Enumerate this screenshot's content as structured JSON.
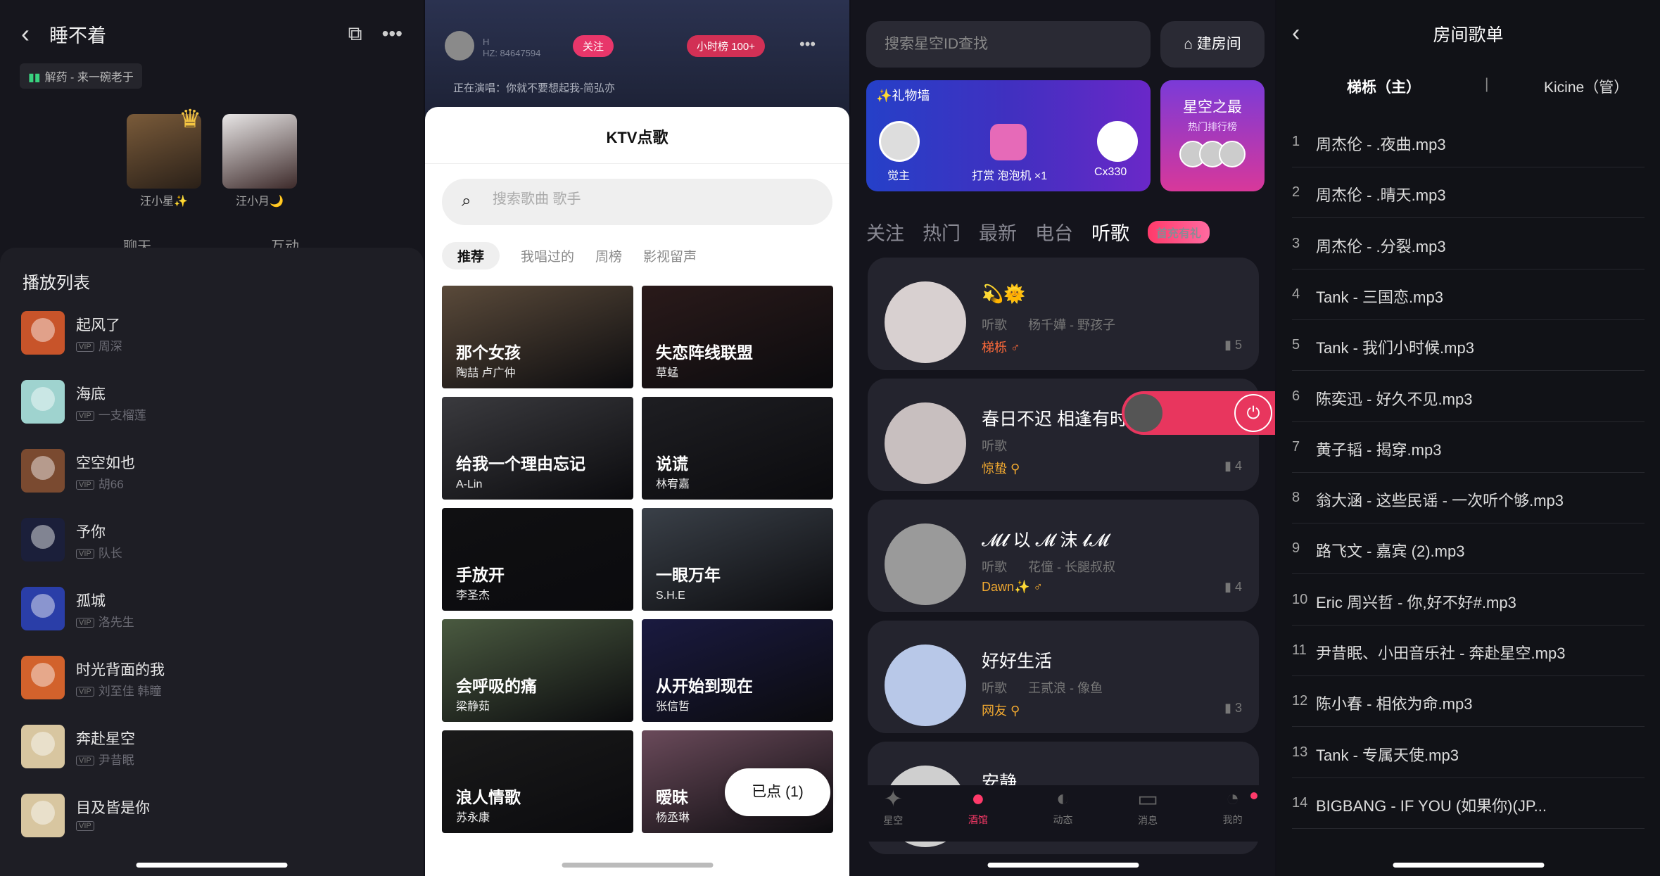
{
  "p1": {
    "title": "睡不着",
    "now_playing": "解药 - 来一碗老于",
    "seats": [
      {
        "name": "汪小星✨"
      },
      {
        "name": "汪小月🌙"
      }
    ],
    "tabs": [
      "聊天",
      "互动"
    ],
    "playlist_title": "播放列表",
    "playlist": [
      {
        "title": "起风了",
        "artist": "周深",
        "color": "#c8542a"
      },
      {
        "title": "海底",
        "artist": "一支榴莲",
        "color": "#9fd3cf"
      },
      {
        "title": "空空如也",
        "artist": "胡66",
        "color": "#7a4a30"
      },
      {
        "title": "予你",
        "artist": "队长",
        "color": "#1b1f3a"
      },
      {
        "title": "孤城",
        "artist": "洛先生",
        "color": "#2a3ea8"
      },
      {
        "title": "时光背面的我",
        "artist": "刘至佳 韩瞳",
        "color": "#d2622c"
      },
      {
        "title": "奔赴星空",
        "artist": "尹昔眠",
        "color": "#d8c6a0"
      },
      {
        "title": "目及皆是你",
        "artist": "",
        "color": "#d8c6a0"
      }
    ],
    "vip": "VIP"
  },
  "p2": {
    "host_line1": "H",
    "host_line2": "HZ: 84647594",
    "follow": "关注",
    "rank": "小时榜 100+",
    "singing": "正在演唱：你就不要想起我-简弘亦",
    "sheet_title": "KTV点歌",
    "search_placeholder": "搜索歌曲 歌手",
    "tabs": [
      "推荐",
      "我唱过的",
      "周榜",
      "影视留声"
    ],
    "songs": [
      {
        "title": "那个女孩",
        "artist": "陶喆 卢广仲",
        "bg": "#5a4a3a"
      },
      {
        "title": "失恋阵线联盟",
        "artist": "草蜢",
        "bg": "#2a1a1a"
      },
      {
        "title": "给我一个理由忘记",
        "artist": "A-Lin",
        "bg": "#3a3a3e"
      },
      {
        "title": "说谎",
        "artist": "林宥嘉",
        "bg": "#1e1e22"
      },
      {
        "title": "手放开",
        "artist": "李圣杰",
        "bg": "#101012"
      },
      {
        "title": "一眼万年",
        "artist": "S.H.E",
        "bg": "#3a4048"
      },
      {
        "title": "会呼吸的痛",
        "artist": "梁静茹",
        "bg": "#4a5a40"
      },
      {
        "title": "从开始到现在",
        "artist": "张信哲",
        "bg": "#1a1a40"
      },
      {
        "title": "浪人情歌",
        "artist": "苏永康",
        "bg": "#1a1a1a"
      },
      {
        "title": "暧昧",
        "artist": "杨丞琳",
        "bg": "#6a4a5a"
      }
    ],
    "picked_button": "已点 (1)"
  },
  "p3": {
    "search_placeholder": "搜索星空ID查找",
    "build_button": "建房间",
    "gift_wall": {
      "label": "✨礼物墙",
      "left_user": "觉主",
      "action": "打赏 泡泡机 ×1",
      "right_user": "Cx330"
    },
    "best": {
      "title": "星空之最",
      "subtitle": "热门排行榜"
    },
    "cat_tabs": [
      "关注",
      "热门",
      "最新",
      "电台",
      "听歌"
    ],
    "promo": "首充有礼",
    "rooms": [
      {
        "name": "💫🌞",
        "type": "听歌",
        "song": "杨千嬅 - 野孩子",
        "host": "梯栎 ♂",
        "host_color": "#ff6a3a",
        "count": "5"
      },
      {
        "name": "春日不迟 相逢有时",
        "type": "听歌",
        "song": "",
        "host": "惊蛰 ⚲",
        "host_color": "#f0a830",
        "count": "4"
      },
      {
        "name": "𝓜𝓵 以 𝓜 沫 𝓵𝓜",
        "type": "听歌",
        "song": "花僮 - 长腿叔叔",
        "host": "Dawn✨ ♂",
        "host_color": "#f0a830",
        "count": "4"
      },
      {
        "name": "好好生活",
        "type": "听歌",
        "song": "王贰浪 - 像鱼",
        "host": "网友 ⚲",
        "host_color": "#f0a830",
        "count": "3"
      },
      {
        "name": "安静",
        "type": "",
        "song": "",
        "host": "",
        "host_color": "#fff",
        "count": ""
      }
    ],
    "tabbar": [
      "星空",
      "酒馆",
      "动态",
      "消息",
      "我的"
    ]
  },
  "p4": {
    "title": "房间歌单",
    "owner": "梯栎（主）",
    "separator": "|",
    "admin": "Kicine（管）",
    "queue": [
      "周杰伦 - .夜曲.mp3",
      "周杰伦 - .晴天.mp3",
      "周杰伦 - .分裂.mp3",
      "Tank - 三国恋.mp3",
      "Tank - 我们小时候.mp3",
      "陈奕迅 - 好久不见.mp3",
      "黄子韬 - 揭穿.mp3",
      "翁大涵 - 这些民谣 - 一次听个够.mp3",
      "路飞文 - 嘉宾 (2).mp3",
      "Eric 周兴哲 - 你,好不好#.mp3",
      "尹昔眠、小田音乐社 - 奔赴星空.mp3",
      "陈小春 - 相依为命.mp3",
      "Tank - 专属天使.mp3",
      "BIGBANG - IF YOU (如果你)(JP..."
    ]
  }
}
